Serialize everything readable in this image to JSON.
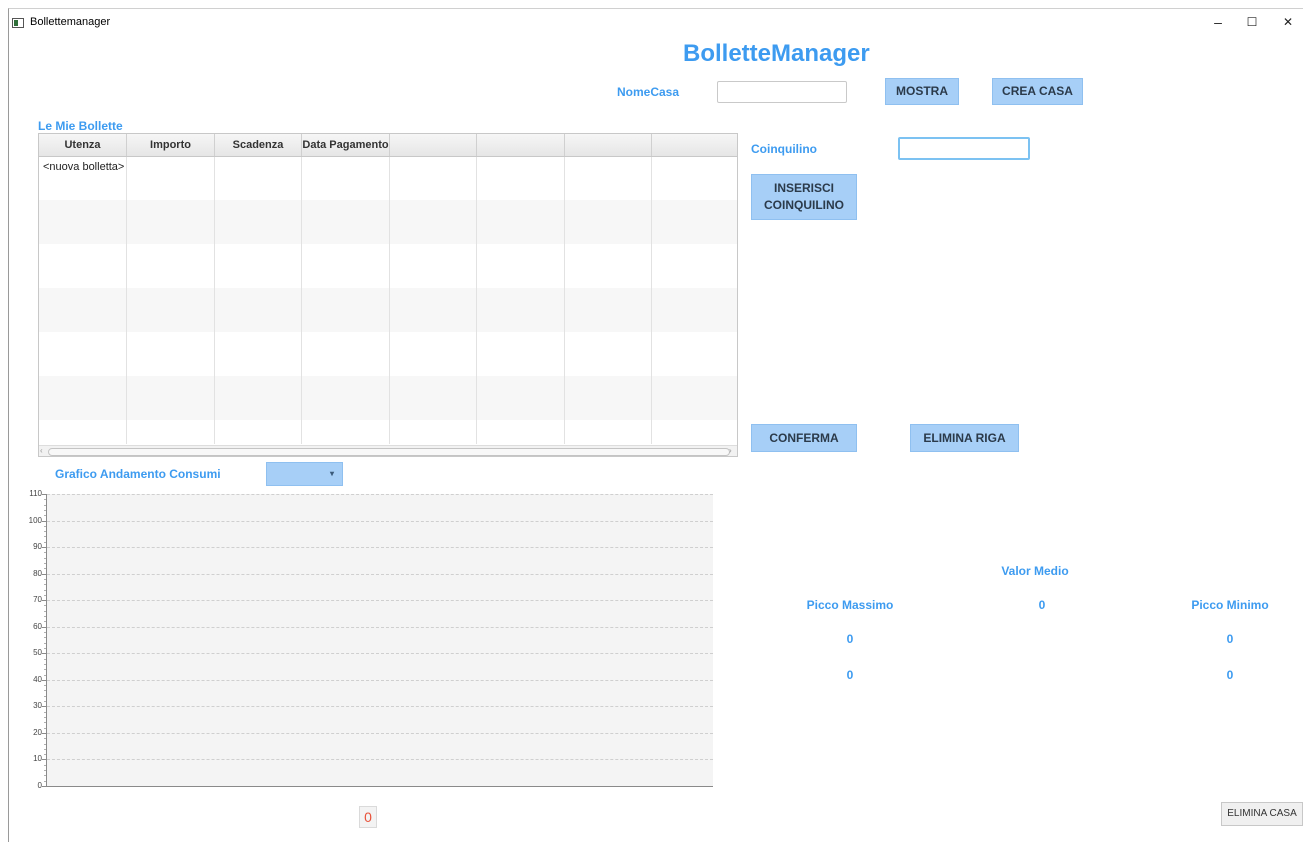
{
  "window": {
    "title": "Bollettemanager",
    "minimize": "–",
    "maximize": "☐",
    "close": "✕"
  },
  "header": {
    "app_title": "BolletteManager"
  },
  "casa": {
    "label": "NomeCasa",
    "value": "",
    "mostra_label": "MOSTRA",
    "crea_label": "CREA CASA"
  },
  "bollette": {
    "title": "Le Mie Bollette",
    "columns": [
      "Utenza",
      "Importo",
      "Scadenza",
      "Data Pagamento",
      "",
      "",
      "",
      ""
    ],
    "rows": [
      [
        "<nuova bolletta>",
        "",
        "",
        "",
        "",
        "",
        "",
        ""
      ]
    ]
  },
  "coinquilino": {
    "label": "Coinquilino",
    "value": "",
    "inserisci_line1": "INSERISCI",
    "inserisci_line2": "COINQUILINO"
  },
  "actions": {
    "conferma_label": "CONFERMA",
    "elimina_riga_label": "ELIMINA RIGA",
    "elimina_casa_label": "ELIMINA CASA"
  },
  "grafico": {
    "title": "Grafico Andamento Consumi",
    "selected": "",
    "counter": "0"
  },
  "stats": {
    "valor_medio_label": "Valor Medio",
    "valor_medio_value": "0",
    "picco_massimo_label": "Picco Massimo",
    "picco_massimo_value1": "0",
    "picco_massimo_value2": "0",
    "picco_minimo_label": "Picco Minimo",
    "picco_minimo_value1": "0",
    "picco_minimo_value2": "0"
  },
  "chart_data": {
    "type": "line",
    "title": "",
    "xlabel": "",
    "ylabel": "",
    "series": [],
    "ylim": [
      0,
      110
    ],
    "y_ticks": [
      "0",
      "10",
      "20",
      "30",
      "40",
      "50",
      "60",
      "70",
      "80",
      "90",
      "100",
      "110"
    ],
    "grid": true
  },
  "colors": {
    "accent": "#3d9bf0",
    "button_bg": "#a7cff7",
    "counter": "#e8523a"
  }
}
